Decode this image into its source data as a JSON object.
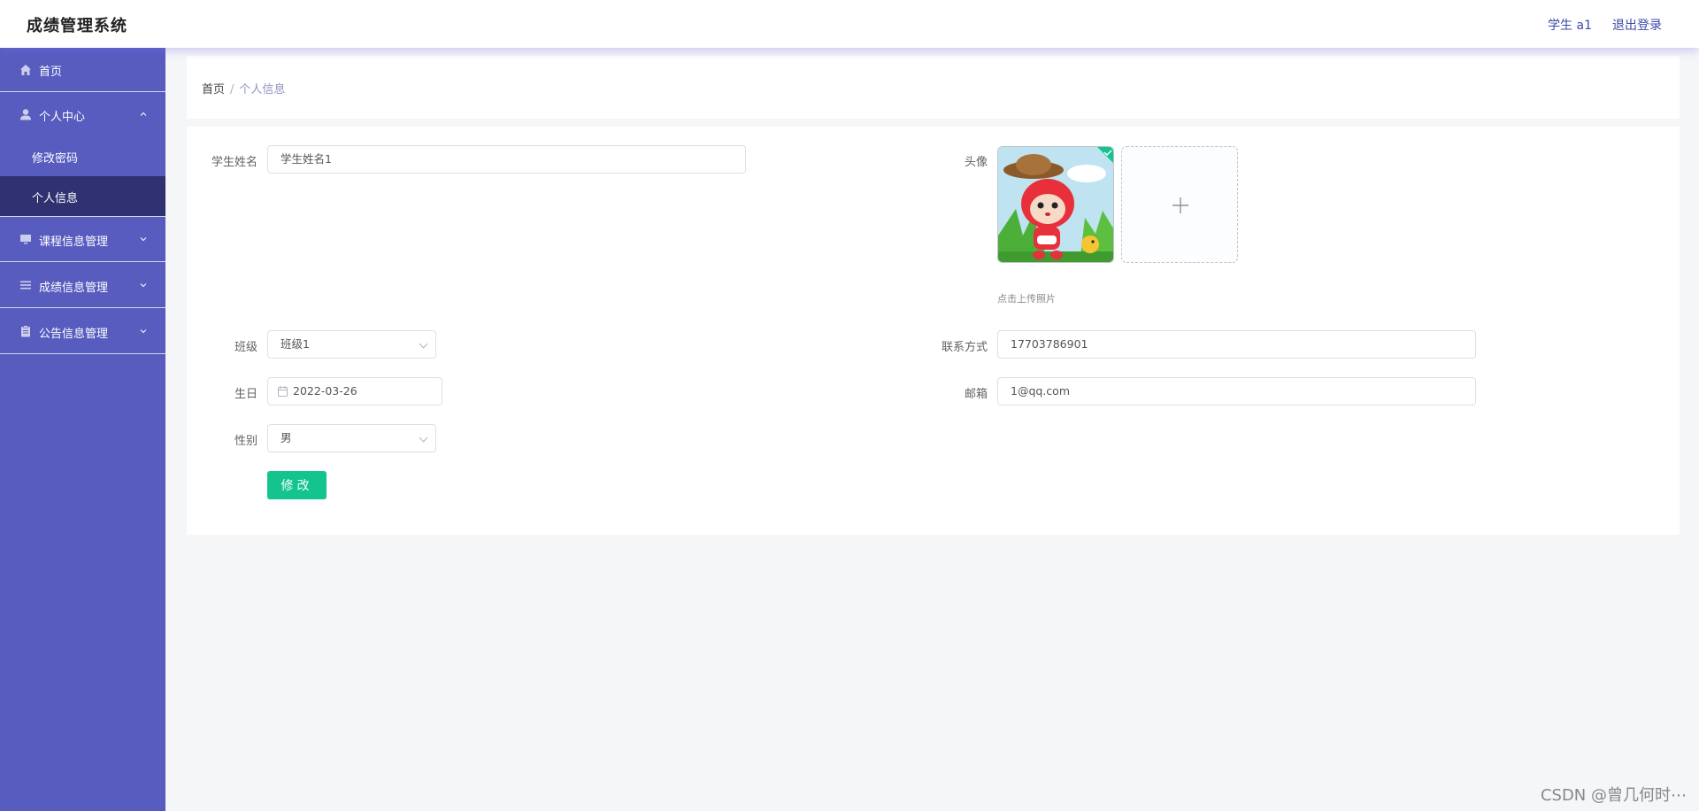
{
  "header": {
    "app_title": "成绩管理系统",
    "user_label": "学生 a1",
    "logout_label": "退出登录"
  },
  "sidebar": {
    "items": [
      {
        "label": "首页",
        "icon": "home-icon"
      },
      {
        "label": "个人中心",
        "icon": "user-icon",
        "expanded": true,
        "children": [
          {
            "label": "修改密码",
            "active": false
          },
          {
            "label": "个人信息",
            "active": true
          }
        ]
      },
      {
        "label": "课程信息管理",
        "icon": "monitor-icon",
        "expanded": false
      },
      {
        "label": "成绩信息管理",
        "icon": "list-icon",
        "expanded": false
      },
      {
        "label": "公告信息管理",
        "icon": "clipboard-icon",
        "expanded": false
      }
    ]
  },
  "breadcrumb": {
    "home": "首页",
    "separator": "/",
    "current": "个人信息"
  },
  "form": {
    "name_label": "学生姓名",
    "name_value": "学生姓名1",
    "avatar_label": "头像",
    "upload_hint": "点击上传照片",
    "class_label": "班级",
    "class_value": "班级1",
    "contact_label": "联系方式",
    "contact_value": "17703786901",
    "birthday_label": "生日",
    "birthday_value": "2022-03-26",
    "email_label": "邮箱",
    "email_value": "1@qq.com",
    "gender_label": "性别",
    "gender_value": "男",
    "submit_label": "修改"
  },
  "watermark": "CSDN @曾几何时⋯",
  "colors": {
    "sidebar_bg": "#585cbf",
    "sidebar_active": "#2f3170",
    "accent_button": "#13c48e",
    "link": "#3e4aa8"
  }
}
